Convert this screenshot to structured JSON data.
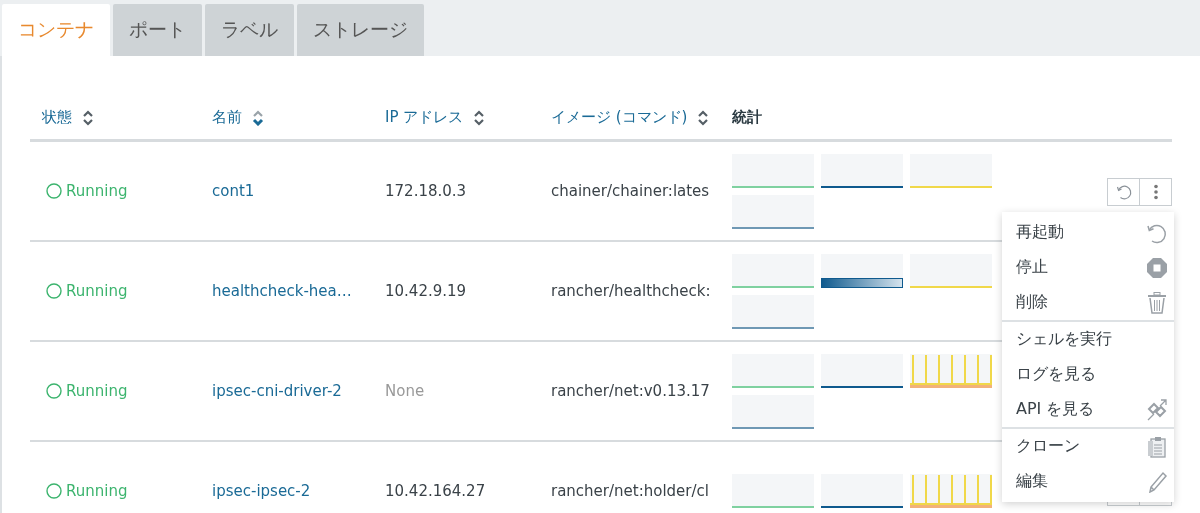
{
  "tabs": [
    {
      "label": "コンテナ",
      "selected": true
    },
    {
      "label": "ポート",
      "selected": false
    },
    {
      "label": "ラベル",
      "selected": false
    },
    {
      "label": "ストレージ",
      "selected": false
    }
  ],
  "table": {
    "columns": [
      {
        "label": "状態",
        "sortable": true,
        "sorted": false
      },
      {
        "label": "名前",
        "sortable": true,
        "sorted": true
      },
      {
        "label": "IP アドレス",
        "sortable": true,
        "sorted": false
      },
      {
        "label": "イメージ (コマンド)",
        "sortable": true,
        "sorted": false
      },
      {
        "label": "統計",
        "sortable": false
      }
    ],
    "rows": [
      {
        "status": "Running",
        "name": "cont1",
        "ip": "172.18.0.3",
        "ip_empty": false,
        "image": "chainer/chainer:lates",
        "graphs": [
          {
            "kind": "flat"
          },
          {
            "kind": "flat"
          },
          {
            "kind": "flat"
          },
          {
            "kind": "flat"
          }
        ]
      },
      {
        "status": "Running",
        "name": "healthcheck-hea…",
        "ip": "10.42.9.19",
        "ip_empty": false,
        "image": "rancher/healthcheck:",
        "graphs": [
          {
            "kind": "flat"
          },
          {
            "kind": "filled"
          },
          {
            "kind": "flat"
          },
          {
            "kind": "flat"
          }
        ]
      },
      {
        "status": "Running",
        "name": "ipsec-cni-driver-2",
        "ip": "None",
        "ip_empty": true,
        "image": "rancher/net:v0.13.17",
        "graphs": [
          {
            "kind": "flat"
          },
          {
            "kind": "flat"
          },
          {
            "kind": "spikes"
          },
          {
            "kind": "flat"
          }
        ]
      },
      {
        "status": "Running",
        "name": "ipsec-ipsec-2",
        "ip": "10.42.164.27",
        "ip_empty": false,
        "image": "rancher/net:holder/cl",
        "graphs": [
          {
            "kind": "flat"
          },
          {
            "kind": "flat"
          },
          {
            "kind": "spikes"
          }
        ]
      }
    ]
  },
  "menu": {
    "groups": [
      [
        {
          "label": "再起動"
        },
        {
          "label": "停止"
        },
        {
          "label": "削除"
        }
      ],
      [
        {
          "label": "シェルを実行"
        },
        {
          "label": "ログを見る"
        },
        {
          "label": "API を見る"
        }
      ],
      [
        {
          "label": "クローン"
        },
        {
          "label": "編集"
        }
      ]
    ]
  }
}
